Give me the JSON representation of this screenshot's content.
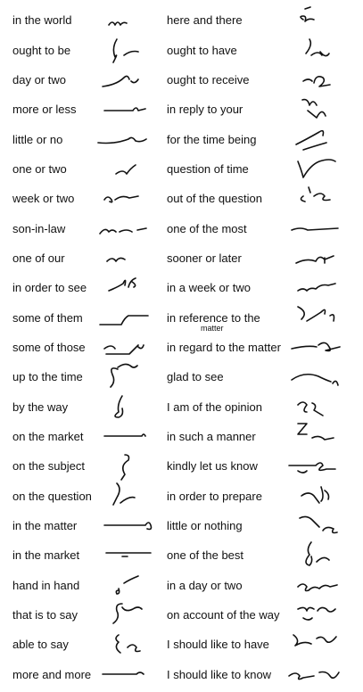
{
  "left_column": [
    {
      "phrase": "in the world",
      "outline": "outline-in-the-world"
    },
    {
      "phrase": "ought to be",
      "outline": "outline-ought-to-be"
    },
    {
      "phrase": "day or two",
      "outline": "outline-day-or-two"
    },
    {
      "phrase": "more or less",
      "outline": "outline-more-or-less"
    },
    {
      "phrase": "little or no",
      "outline": "outline-little-or-no"
    },
    {
      "phrase": "one or two",
      "outline": "outline-one-or-two"
    },
    {
      "phrase": "week or two",
      "outline": "outline-week-or-two"
    },
    {
      "phrase": "son-in-law",
      "outline": "outline-son-in-law"
    },
    {
      "phrase": "one of our",
      "outline": "outline-one-of-our"
    },
    {
      "phrase": "in order to see",
      "outline": "outline-in-order-to-see"
    },
    {
      "phrase": "some of them",
      "outline": "outline-some-of-them"
    },
    {
      "phrase": "some of those",
      "outline": "outline-some-of-those"
    },
    {
      "phrase": "up to the time",
      "outline": "outline-up-to-the-time"
    },
    {
      "phrase": "by the way",
      "outline": "outline-by-the-way"
    },
    {
      "phrase": "on the market",
      "outline": "outline-on-the-market"
    },
    {
      "phrase": "on the subject",
      "outline": "outline-on-the-subject"
    },
    {
      "phrase": "on the question",
      "outline": "outline-on-the-question"
    },
    {
      "phrase": "in the matter",
      "outline": "outline-in-the-matter"
    },
    {
      "phrase": "in the market",
      "outline": "outline-in-the-market"
    },
    {
      "phrase": "hand in hand",
      "outline": "outline-hand-in-hand"
    },
    {
      "phrase": "that is to say",
      "outline": "outline-that-is-to-say"
    },
    {
      "phrase": "able to say",
      "outline": "outline-able-to-say"
    },
    {
      "phrase": "more and more",
      "outline": "outline-more-and-more"
    }
  ],
  "right_column": [
    {
      "phrase": "here and there",
      "outline": "outline-here-and-there"
    },
    {
      "phrase": "ought to have",
      "outline": "outline-ought-to-have"
    },
    {
      "phrase": "ought to receive",
      "outline": "outline-ought-to-receive"
    },
    {
      "phrase": "in reply to your",
      "outline": "outline-in-reply-to-your"
    },
    {
      "phrase": "for the time being",
      "outline": "outline-for-the-time-being"
    },
    {
      "phrase": "question of time",
      "outline": "outline-question-of-time"
    },
    {
      "phrase": "out of the question",
      "outline": "outline-out-of-the-question"
    },
    {
      "phrase": "one of the most",
      "outline": "outline-one-of-the-most"
    },
    {
      "phrase": "sooner or later",
      "outline": "outline-sooner-or-later"
    },
    {
      "phrase": "in a week or two",
      "outline": "outline-in-a-week-or-two"
    },
    {
      "phrase": "in reference to the",
      "sub": "matter",
      "outline": "outline-in-reference-to-the-matter"
    },
    {
      "phrase": "in regard to the matter",
      "outline": "outline-in-regard-to-the-matter"
    },
    {
      "phrase": "glad to see",
      "outline": "outline-glad-to-see"
    },
    {
      "phrase": "I am of the opinion",
      "outline": "outline-i-am-of-the-opinion"
    },
    {
      "phrase": "in such a manner",
      "outline": "outline-in-such-a-manner"
    },
    {
      "phrase": "kindly let us know",
      "outline": "outline-kindly-let-us-know"
    },
    {
      "phrase": "in order to prepare",
      "outline": "outline-in-order-to-prepare"
    },
    {
      "phrase": "little or nothing",
      "outline": "outline-little-or-nothing"
    },
    {
      "phrase": "one of the best",
      "outline": "outline-one-of-the-best"
    },
    {
      "phrase": "in a day or two",
      "outline": "outline-in-a-day-or-two"
    },
    {
      "phrase": "on account of the way",
      "outline": "outline-on-account-of-the-way"
    },
    {
      "phrase": "I should like to have",
      "outline": "outline-i-should-like-to-have"
    },
    {
      "phrase": "I should like to know",
      "outline": "outline-i-should-like-to-know"
    }
  ],
  "colors": {
    "ink": "#111111",
    "background": "#ffffff"
  }
}
